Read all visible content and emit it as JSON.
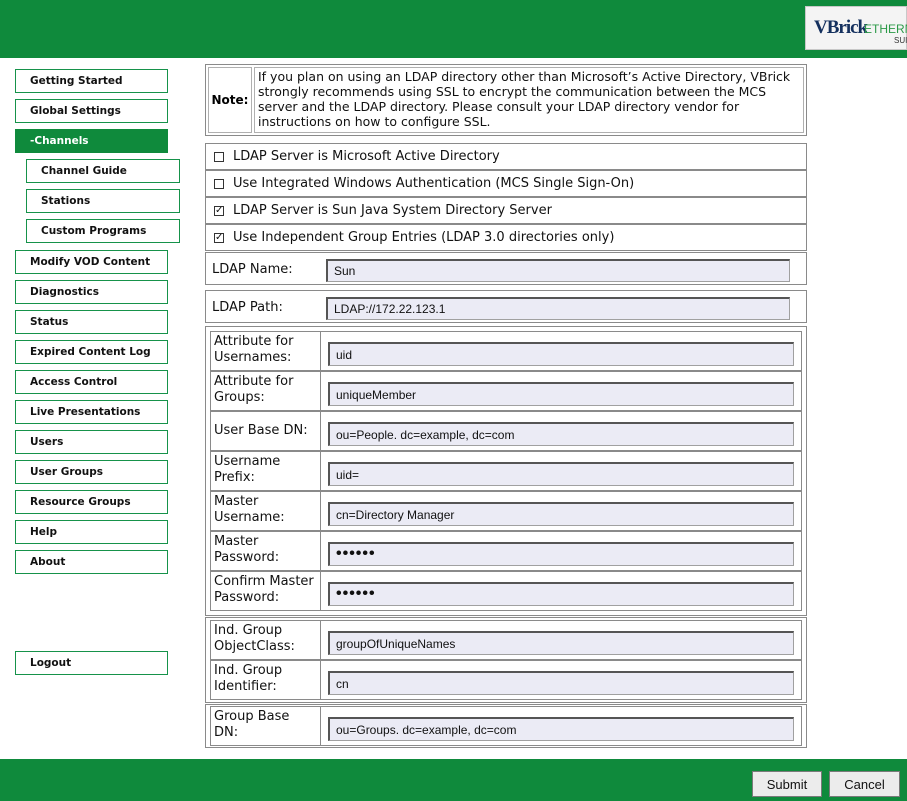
{
  "header": {
    "logo": {
      "brand": "VBrick",
      "product": "ETHERNET",
      "suite": "SUIT"
    }
  },
  "sidebar": {
    "items": [
      {
        "label": "Getting Started"
      },
      {
        "label": "Global Settings"
      },
      {
        "label": "-Channels",
        "active": true
      },
      {
        "label": "Channel Guide"
      },
      {
        "label": "Stations"
      },
      {
        "label": "Custom Programs"
      },
      {
        "label": "Modify VOD Content"
      },
      {
        "label": "Diagnostics"
      },
      {
        "label": "Status"
      },
      {
        "label": "Expired Content Log"
      },
      {
        "label": "Access Control"
      },
      {
        "label": "Live Presentations"
      },
      {
        "label": "Users"
      },
      {
        "label": "User Groups"
      },
      {
        "label": "Resource Groups"
      },
      {
        "label": "Help"
      },
      {
        "label": "About"
      }
    ],
    "logout": "Logout"
  },
  "note": {
    "label": "Note:",
    "text": "If you plan on using an LDAP directory other than Microsoft’s Active Directory, VBrick strongly recommends using SSL to encrypt the communication between the MCS server and the LDAP directory. Please consult your LDAP directory vendor for instructions on how to configure SSL."
  },
  "options": [
    {
      "label": "LDAP Server is Microsoft Active Directory",
      "checked": false
    },
    {
      "label": "Use Integrated Windows Authentication (MCS Single Sign-On)",
      "checked": false
    },
    {
      "label": "LDAP Server is Sun Java System Directory Server",
      "checked": true
    },
    {
      "label": "Use Independent Group Entries (LDAP 3.0 directories only)",
      "checked": true
    }
  ],
  "ldap_name": {
    "label": "LDAP Name:",
    "value": "Sun"
  },
  "ldap_path": {
    "label": "LDAP Path:",
    "value": "LDAP://172.22.123.1"
  },
  "attributes": [
    {
      "label": "Attribute for Usernames:",
      "value": "uid"
    },
    {
      "label": "Attribute for Groups:",
      "value": "uniqueMember"
    },
    {
      "label": "User Base DN:",
      "value": "ou=People. dc=example, dc=com"
    },
    {
      "label": "Username Prefix:",
      "value": "uid="
    },
    {
      "label": "Master Username:",
      "value": "cn=Directory Manager"
    },
    {
      "label": "Master Password:",
      "value": "••••••"
    },
    {
      "label": "Confirm Master Password:",
      "value": "••••••"
    }
  ],
  "group_settings": [
    {
      "label": "Ind. Group ObjectClass:",
      "value": "groupOfUniqueNames"
    },
    {
      "label": "Ind. Group Identifier:",
      "value": "cn"
    }
  ],
  "group_base": {
    "label": "Group Base DN:",
    "value": "ou=Groups. dc=example, dc=com"
  },
  "buttons": {
    "submit": "Submit",
    "cancel": "Cancel"
  },
  "colors": {
    "accent": "#0f8a3c",
    "input_bg": "#ebebf5"
  }
}
